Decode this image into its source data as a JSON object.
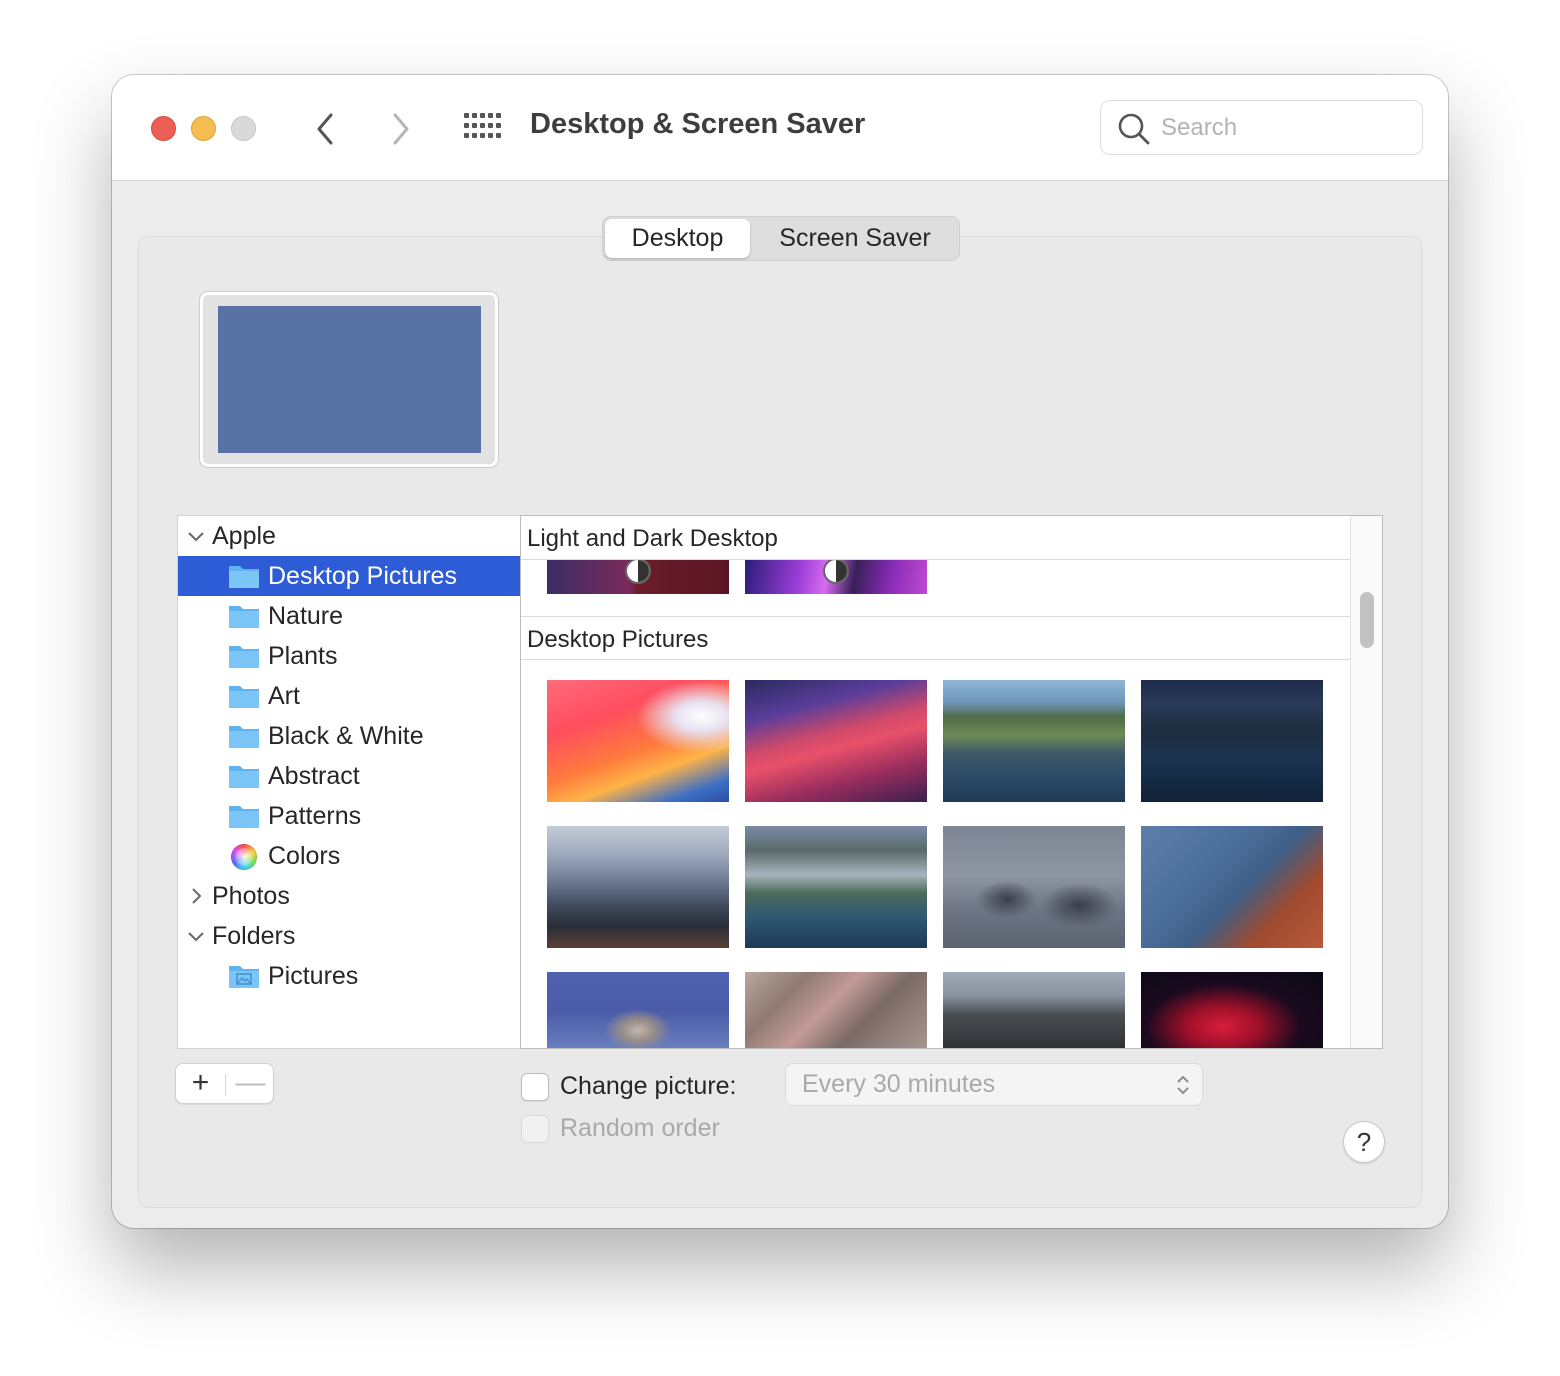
{
  "window": {
    "title": "Desktop & Screen Saver"
  },
  "search": {
    "placeholder": "Search"
  },
  "tabs": [
    {
      "label": "Desktop",
      "selected": true
    },
    {
      "label": "Screen Saver",
      "selected": false
    }
  ],
  "preview": {
    "color": "#5872a6"
  },
  "sidebar": {
    "groups": [
      {
        "label": "Apple",
        "expanded": true
      },
      {
        "label": "Photos",
        "expanded": false
      },
      {
        "label": "Folders",
        "expanded": true
      }
    ],
    "apple_items": [
      {
        "label": "Desktop Pictures",
        "icon": "folder-icon",
        "selected": true
      },
      {
        "label": "Nature",
        "icon": "folder-icon"
      },
      {
        "label": "Plants",
        "icon": "folder-icon"
      },
      {
        "label": "Art",
        "icon": "folder-icon"
      },
      {
        "label": "Black & White",
        "icon": "folder-icon"
      },
      {
        "label": "Abstract",
        "icon": "folder-icon"
      },
      {
        "label": "Patterns",
        "icon": "folder-icon"
      },
      {
        "label": "Colors",
        "icon": "color-wheel-icon"
      }
    ],
    "folder_items": [
      {
        "label": "Pictures",
        "icon": "pictures-folder-icon"
      }
    ],
    "add_label": "+",
    "remove_label": "—"
  },
  "gallery": {
    "sections": [
      {
        "title": "Light and Dark Desktop"
      },
      {
        "title": "Desktop Pictures"
      }
    ]
  },
  "options": {
    "change_picture_label": "Change picture:",
    "change_picture_checked": false,
    "interval": "Every 30 minutes",
    "random_order_label": "Random order",
    "random_order_checked": false
  },
  "help": {
    "label": "?"
  }
}
